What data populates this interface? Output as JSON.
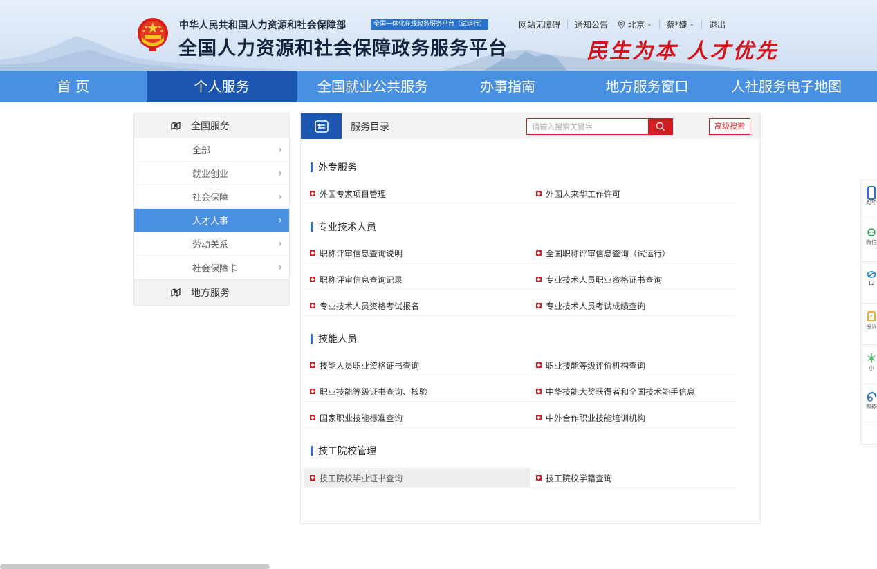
{
  "header": {
    "ministry": "中华人民共和国人力资源和社会保障部",
    "badge": "全国一体化在线政务服务平台（试运行）",
    "title": "全国人力资源和社会保障政务服务平台",
    "slogan": "民生为本 人才优先",
    "links": {
      "accessibility": "网站无障碍",
      "notice": "通知公告",
      "city": "北京",
      "user": "蔡*婕",
      "logout": "退出"
    }
  },
  "nav": {
    "items": [
      {
        "label": "首 页"
      },
      {
        "label": "个人服务",
        "active": true
      },
      {
        "label": "全国就业公共服务"
      },
      {
        "label": "办事指南"
      },
      {
        "label": "地方服务窗口"
      },
      {
        "label": "人社服务电子地图"
      }
    ]
  },
  "sidebar": {
    "group1": "全国服务",
    "items": [
      {
        "label": "全部"
      },
      {
        "label": "就业创业"
      },
      {
        "label": "社会保障"
      },
      {
        "label": "人才人事",
        "active": true
      },
      {
        "label": "劳动关系"
      },
      {
        "label": "社会保障卡"
      }
    ],
    "group2": "地方服务"
  },
  "panel": {
    "title": "服务目录",
    "search_placeholder": "请输入搜索关键字",
    "advanced_search": "高级搜索",
    "sections": [
      {
        "title": "外专服务",
        "items": [
          "外国专家项目管理",
          "外国人来华工作许可"
        ]
      },
      {
        "title": "专业技术人员",
        "items": [
          "职称评审信息查询说明",
          "全国职称评审信息查询（试运行）",
          "职称评审信息查询记录",
          "专业技术人员职业资格证书查询",
          "专业技术人员资格考试报名",
          "专业技术人员考试成绩查询"
        ]
      },
      {
        "title": "技能人员",
        "items": [
          "技能人员职业资格证书查询",
          "职业技能等级评价机构查询",
          "职业技能等级证书查询、核验",
          "中华技能大奖获得者和全国技术能手信息",
          "国家职业技能标准查询",
          "中外合作职业技能培训机构"
        ]
      },
      {
        "title": "技工院校管理",
        "items": [
          "技工院校毕业证书查询",
          "技工院校学籍查询"
        ]
      }
    ]
  },
  "float_bar": {
    "items": [
      {
        "label": "APP",
        "icon": "phone-icon",
        "color": "#2a72cf"
      },
      {
        "label": "微信",
        "icon": "wechat-icon",
        "color": "#27b04a"
      },
      {
        "label": "12",
        "icon": "hotline-icon",
        "color": "#1e8fd6"
      },
      {
        "label": "投诉",
        "icon": "complaint-icon",
        "color": "#f2a31b"
      },
      {
        "label": "小",
        "icon": "mini-program-icon",
        "color": "#3cba54"
      },
      {
        "label": "智能",
        "icon": "assistant-icon",
        "color": "#2a72cf"
      }
    ]
  },
  "colors": {
    "nav_bg": "#4a90e2",
    "nav_active": "#1d56b0",
    "accent_red": "#d21c24",
    "sidebar_active": "#4a90e2"
  }
}
